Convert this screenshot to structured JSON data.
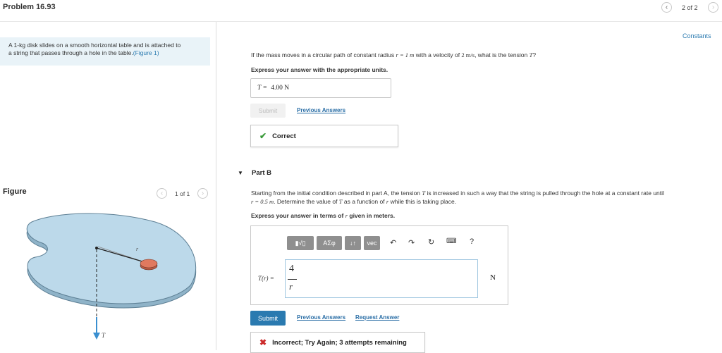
{
  "header": {
    "title": "Problem 16.93",
    "pager_text": "2 of 2",
    "prev_icon": "chevron-left",
    "next_icon": "chevron-right"
  },
  "intro": {
    "line1": "A 1-kg disk slides on a smooth horizontal table and is attached to",
    "line2_text": "a string that passes through a hole in the table.",
    "figure_link": "(Figure 1)"
  },
  "figure": {
    "label": "Figure",
    "pager_text": "1 of 1",
    "r_label": "r",
    "t_label": "T",
    "colors": {
      "table": "#bcd9ea",
      "disk": "#e0795f",
      "force_arrow": "#3a8fd0"
    }
  },
  "constants_link": "Constants",
  "part_a": {
    "question_prefix": "If the mass moves in a circular path of constant radius ",
    "r_eq": "r = 1 m",
    "question_mid": " with a velocity of ",
    "v_val": "2 m/s",
    "question_suffix": ", what is the tension ",
    "t_sym": "T",
    "question_end": "?",
    "instruction": "Express your answer with the appropriate units.",
    "answer_label": "T =",
    "answer_value": "4.00 N",
    "submit_label": "Submit",
    "previous_answers": "Previous Answers",
    "feedback": "Correct",
    "feedback_icon": "check-icon"
  },
  "part_b": {
    "label": "Part B",
    "text1_a": "Starting from the initial condition described in part A, the tension ",
    "text1_t": "T",
    "text1_b": " is increased in such a way that the string is pulled through the hole at a constant rate until",
    "text2_a": "r = 0.5 m",
    "text2_b": ". Determine the value of ",
    "text2_t": "T",
    "text2_c": " as a function of ",
    "text2_r": "r",
    "text2_d": " while this is taking place.",
    "instruction_a": "Express your answer in terms of ",
    "instruction_r": "r",
    "instruction_b": " given in meters.",
    "toolbar": {
      "templates_label": "▮√▯",
      "greek_label": "ΑΣφ",
      "arrows_label": "↓↑",
      "vec_label": "vec",
      "help_label": "?"
    },
    "input_label": "T(r) =",
    "numerator": "4",
    "denominator": "r",
    "unit": "N",
    "submit_label": "Submit",
    "previous_answers": "Previous Answers",
    "request_answer": "Request Answer",
    "feedback": "Incorrect; Try Again; 3 attempts remaining"
  },
  "colors": {
    "accent": "#2a7ab0",
    "correct": "#3a9a3a",
    "incorrect": "#cc2b2b"
  }
}
